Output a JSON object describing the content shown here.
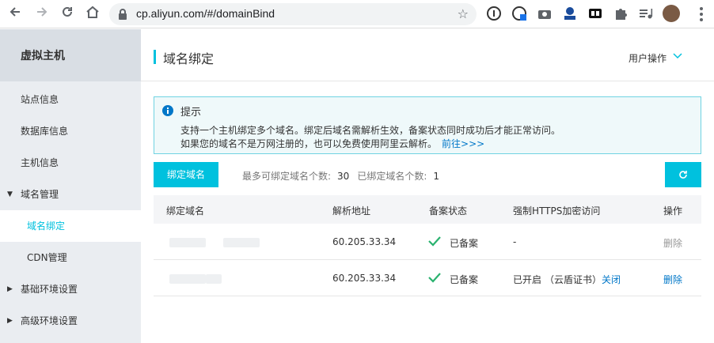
{
  "browser": {
    "url": "cp.aliyun.com/#/domainBind",
    "icons": [
      "back-arrow-icon",
      "forward-arrow-icon",
      "reload-icon",
      "home-icon",
      "lock-icon",
      "star-icon",
      "extension-icons",
      "profile-avatar",
      "menu-icon"
    ]
  },
  "sidebar": {
    "title": "虚拟主机",
    "items": [
      {
        "label": "站点信息"
      },
      {
        "label": "数据库信息"
      },
      {
        "label": "主机信息"
      },
      {
        "label": "域名管理",
        "expanded": true
      },
      {
        "label": "域名绑定",
        "active": true
      },
      {
        "label": "CDN管理"
      },
      {
        "label": "基础环境设置"
      },
      {
        "label": "高级环境设置"
      }
    ]
  },
  "header": {
    "title": "域名绑定",
    "user_ops": "用户操作"
  },
  "notice": {
    "title": "提示",
    "line1": "支持一个主机绑定多个域名。绑定后域名需解析生效，备案状态同时成功后才能正常访问。",
    "line2": "如果您的域名不是万网注册的，也可以免费使用阿里云解析。",
    "goto": "前往>>>"
  },
  "toolbar": {
    "bind_button": "绑定域名",
    "max_label": "最多可绑定域名个数:",
    "max_value": "30",
    "bound_label": "已绑定域名个数:",
    "bound_value": "1"
  },
  "table": {
    "headers": [
      "绑定域名",
      "解析地址",
      "备案状态",
      "强制HTTPS加密访问",
      "操作"
    ],
    "rows": [
      {
        "ip": "60.205.33.34",
        "record": "已备案",
        "https": "-",
        "https_cert": "",
        "https_action": "",
        "op": "删除",
        "op_enabled": false
      },
      {
        "ip": "60.205.33.34",
        "record": "已备案",
        "https": "已开启",
        "https_cert": "（云盾证书）",
        "https_action": "关闭",
        "op": "删除",
        "op_enabled": true
      }
    ]
  },
  "colors": {
    "accent": "#00c1de",
    "link": "#0077c8",
    "check": "#2ab26f"
  }
}
